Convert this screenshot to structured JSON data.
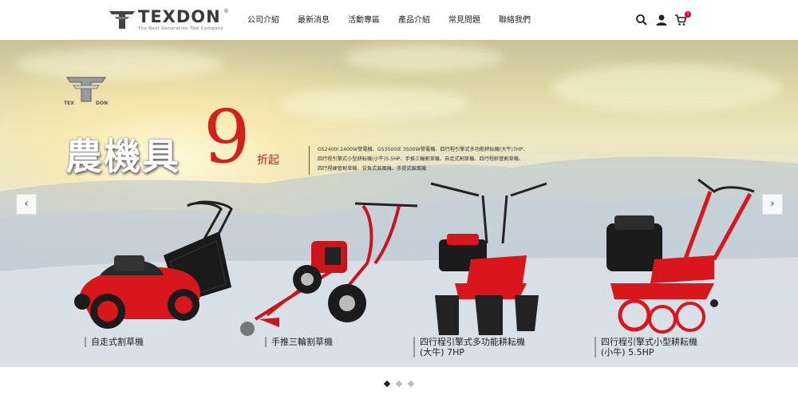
{
  "brand": {
    "name": "TEXDON",
    "reg_mark": "®",
    "tagline": "The Next Generation Tool Company",
    "emblem_text_left": "TEX",
    "emblem_text_right": "DON"
  },
  "nav": {
    "items": [
      "公司介紹",
      "最新消息",
      "活動專區",
      "產品介紹",
      "常見問題",
      "聯絡我們"
    ]
  },
  "header_icons": {
    "search": "search-icon",
    "account": "user-icon",
    "cart": "cart-icon",
    "cart_count": "1"
  },
  "hero": {
    "title": "農機具",
    "number": "9",
    "suffix": "折起",
    "description_lines": [
      "GS2400i 2400W發電機、GS3500iE 3500W發電機、四行程引擎式多功能耕耘機(大牛)7HP、",
      "四行程引擎式小型耕耘機(小牛)5.5HP、手推三輪割草機、自走式割草機、四行程軟管割草機、",
      "四行程硬管割草機、背負式鼓風機、手提式鼓風機"
    ],
    "prev_arrow": "‹",
    "next_arrow": "›"
  },
  "products": [
    {
      "label": "自走式割草機"
    },
    {
      "label": "手推三輪割草機"
    },
    {
      "label": "四行程引擎式多功能耕耘機\n(大牛) 7HP"
    },
    {
      "label": "四行程引擎式小型耕耘機\n(小牛) 5.5HP"
    }
  ],
  "pager": {
    "count": 3,
    "active": 0
  },
  "colors": {
    "accent_red": "#d51f1c",
    "badge_red": "#e3001b",
    "text_dark": "#222222"
  }
}
